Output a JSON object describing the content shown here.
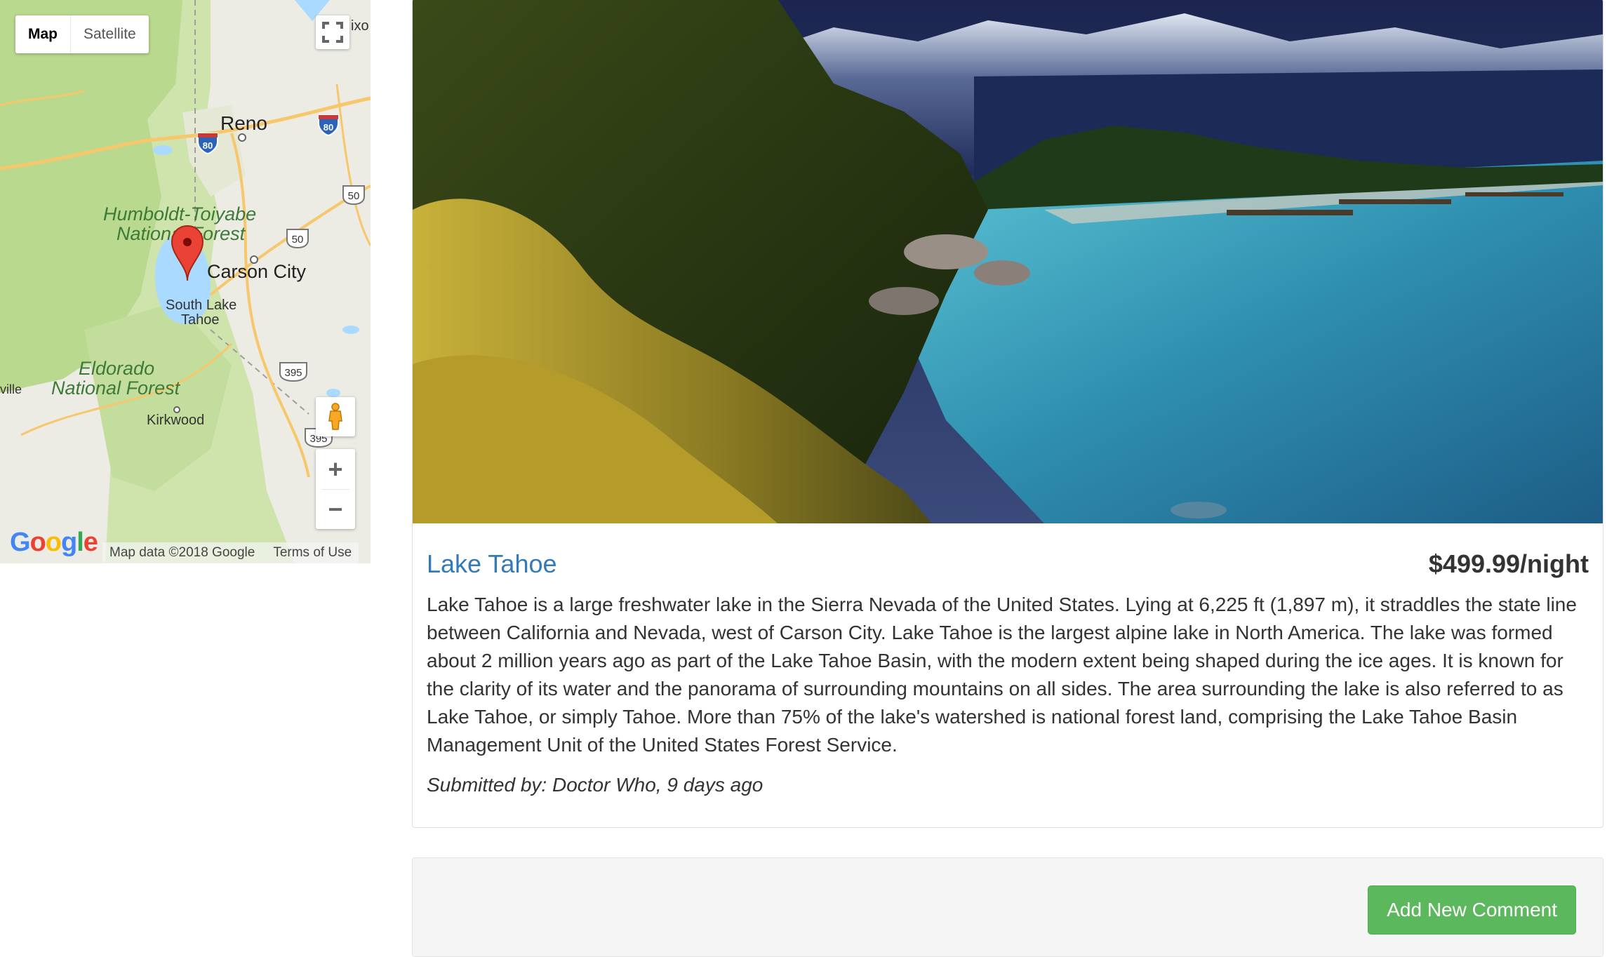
{
  "map": {
    "type_buttons": [
      "Map",
      "Satellite"
    ],
    "active_type": "Map",
    "labels": {
      "reno": "Reno",
      "carson_city": "Carson City",
      "south_lake_tahoe_1": "South Lake",
      "south_lake_tahoe_2": "Tahoe",
      "humboldt_1": "Humboldt-Toiyabe",
      "humboldt_2": "National Forest",
      "eldorado_1": "Eldorado",
      "eldorado_2": "National Forest",
      "kirkwood": "Kirkwood",
      "edge_ixo": "ixo",
      "edge_ville": "ville"
    },
    "shields": [
      "80",
      "80",
      "50",
      "50",
      "395",
      "395"
    ],
    "logo": "Google",
    "attribution": "Map data ©2018 Google",
    "terms": "Terms of Use",
    "zoom_in": "+",
    "zoom_out": "−"
  },
  "campground": {
    "name": "Lake Tahoe",
    "price": "$499.99/night",
    "description": "Lake Tahoe is a large freshwater lake in the Sierra Nevada of the United States. Lying at 6,225 ft (1,897 m), it straddles the state line between California and Nevada, west of Carson City. Lake Tahoe is the largest alpine lake in North America. The lake was formed about 2 million years ago as part of the Lake Tahoe Basin, with the modern extent being shaped during the ice ages. It is known for the clarity of its water and the panorama of surrounding mountains on all sides. The area surrounding the lake is also referred to as Lake Tahoe, or simply Tahoe. More than 75% of the lake's watershed is national forest land, comprising the Lake Tahoe Basin Management Unit of the United States Forest Service.",
    "submitted": "Submitted by: Doctor Who, 9 days ago"
  },
  "comments": {
    "add_button": "Add New Comment"
  },
  "colors": {
    "link": "#337ab7",
    "success": "#5cb85c",
    "water": "#aadaff",
    "land": "#c8e0a5",
    "marker": "#ea4335"
  }
}
